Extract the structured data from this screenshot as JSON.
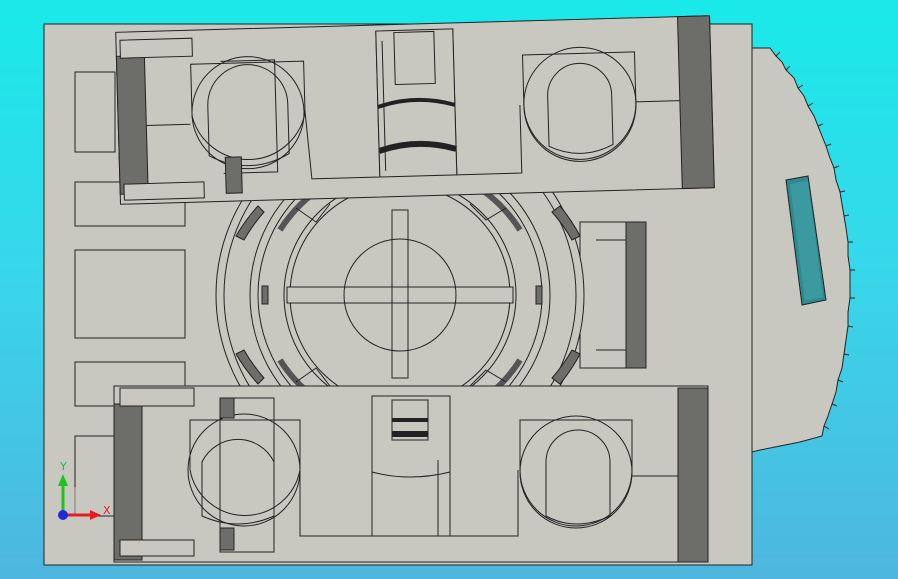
{
  "viewport": {
    "background_top": "#19e9e9",
    "background_bottom": "#4fb6de"
  },
  "model": {
    "body_fill": "#c8c8c0",
    "edge_color": "#222222",
    "dark_face": "#6d6d69",
    "slot_fill": "#2e8a8f"
  },
  "triad": {
    "x_label": "X",
    "y_label": "Y",
    "x_color": "#e02020",
    "y_color": "#20c020",
    "origin_color": "#1f2bd6"
  }
}
